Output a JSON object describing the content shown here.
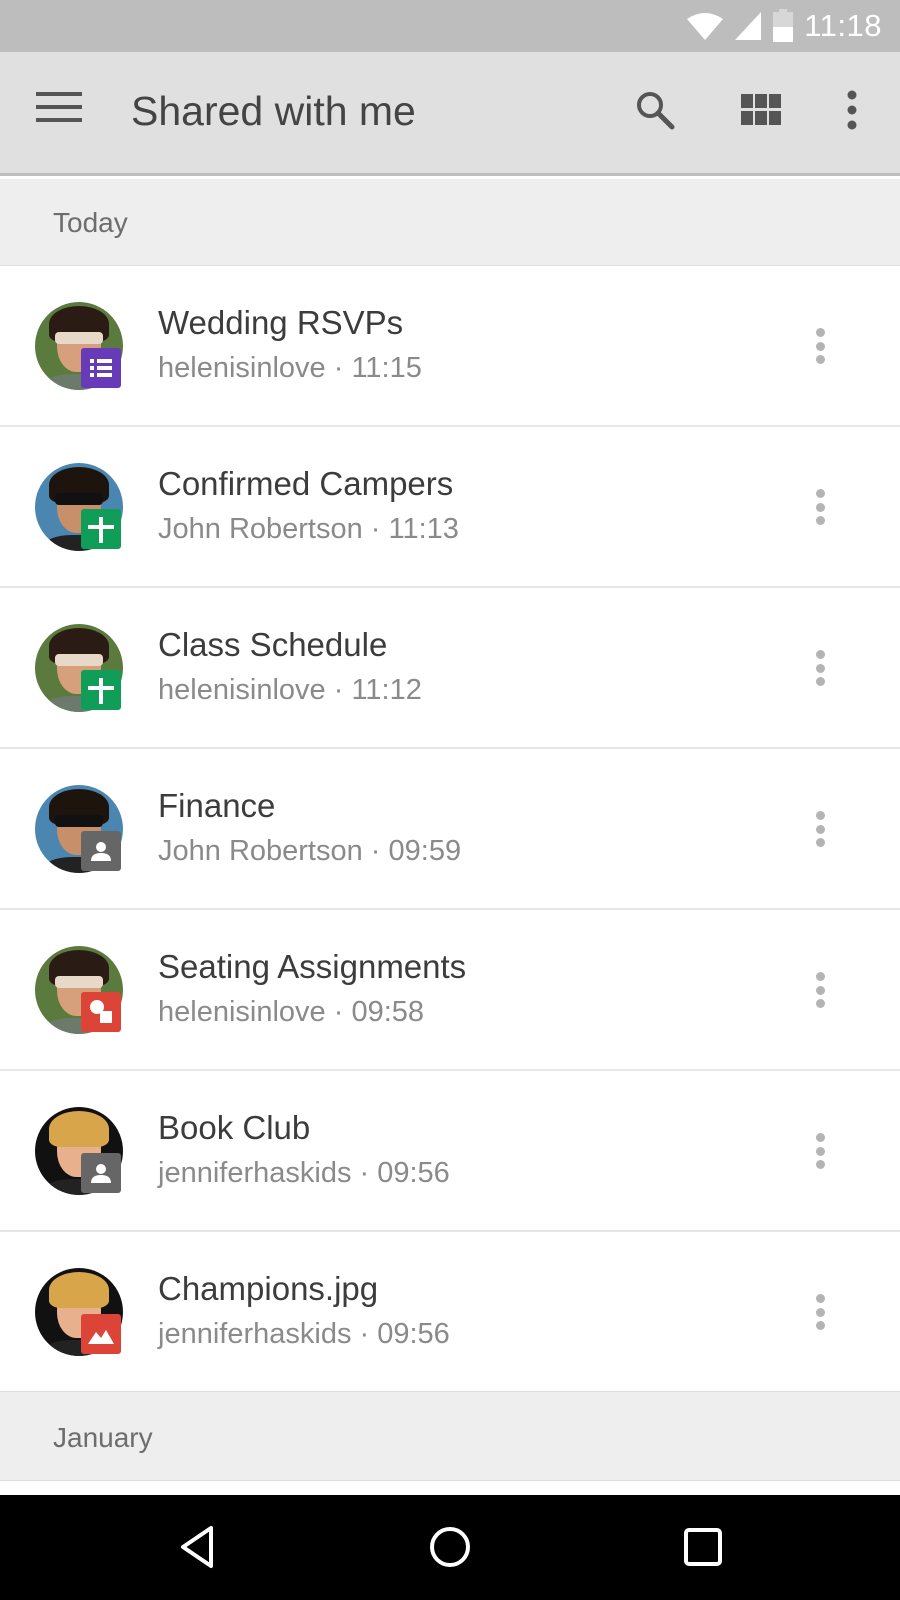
{
  "status_bar": {
    "time": "11:18",
    "icons": [
      "wifi-icon",
      "cellular-signal-icon",
      "battery-icon"
    ]
  },
  "toolbar": {
    "title": "Shared with me",
    "actions": [
      "menu-icon",
      "search-icon",
      "grid-view-icon",
      "more-vert-icon"
    ]
  },
  "sections": [
    {
      "label": "Today",
      "items": [
        {
          "name": "Wedding RSVPs",
          "owner": "helenisinlove",
          "time": "11:15",
          "meta": "helenisinlove · 11:15",
          "type": "forms",
          "type_color": "#673ab7",
          "avatar": "helen"
        },
        {
          "name": "Confirmed Campers",
          "owner": "John Robertson",
          "time": "11:13",
          "meta": "John Robertson · 11:13",
          "type": "sheets",
          "type_color": "#0f9d58",
          "avatar": "john"
        },
        {
          "name": "Class Schedule",
          "owner": "helenisinlove",
          "time": "11:12",
          "meta": "helenisinlove · 11:12",
          "type": "sheets",
          "type_color": "#0f9d58",
          "avatar": "helen"
        },
        {
          "name": "Finance",
          "owner": "John Robertson",
          "time": "09:59",
          "meta": "John Robertson · 09:59",
          "type": "shared-folder",
          "type_color": "#666666",
          "avatar": "john"
        },
        {
          "name": "Seating Assignments",
          "owner": "helenisinlove",
          "time": "09:58",
          "meta": "helenisinlove · 09:58",
          "type": "drawings",
          "type_color": "#db4437",
          "avatar": "helen"
        },
        {
          "name": "Book Club",
          "owner": "jenniferhaskids",
          "time": "09:56",
          "meta": "jenniferhaskids · 09:56",
          "type": "shared-folder",
          "type_color": "#666666",
          "avatar": "jennifer"
        },
        {
          "name": "Champions.jpg",
          "owner": "jenniferhaskids",
          "time": "09:56",
          "meta": "jenniferhaskids · 09:56",
          "type": "image",
          "type_color": "#db4437",
          "avatar": "jennifer"
        }
      ]
    },
    {
      "label": "January",
      "items": []
    }
  ],
  "nav_bar": {
    "buttons": [
      "back-icon",
      "home-icon",
      "recents-icon"
    ]
  },
  "colors": {
    "status_bar": "#bdbdbd",
    "toolbar": "#e0e0e0",
    "section_header": "#eeeeee",
    "title_text": "#444444",
    "secondary_text": "#8a8a8a"
  }
}
